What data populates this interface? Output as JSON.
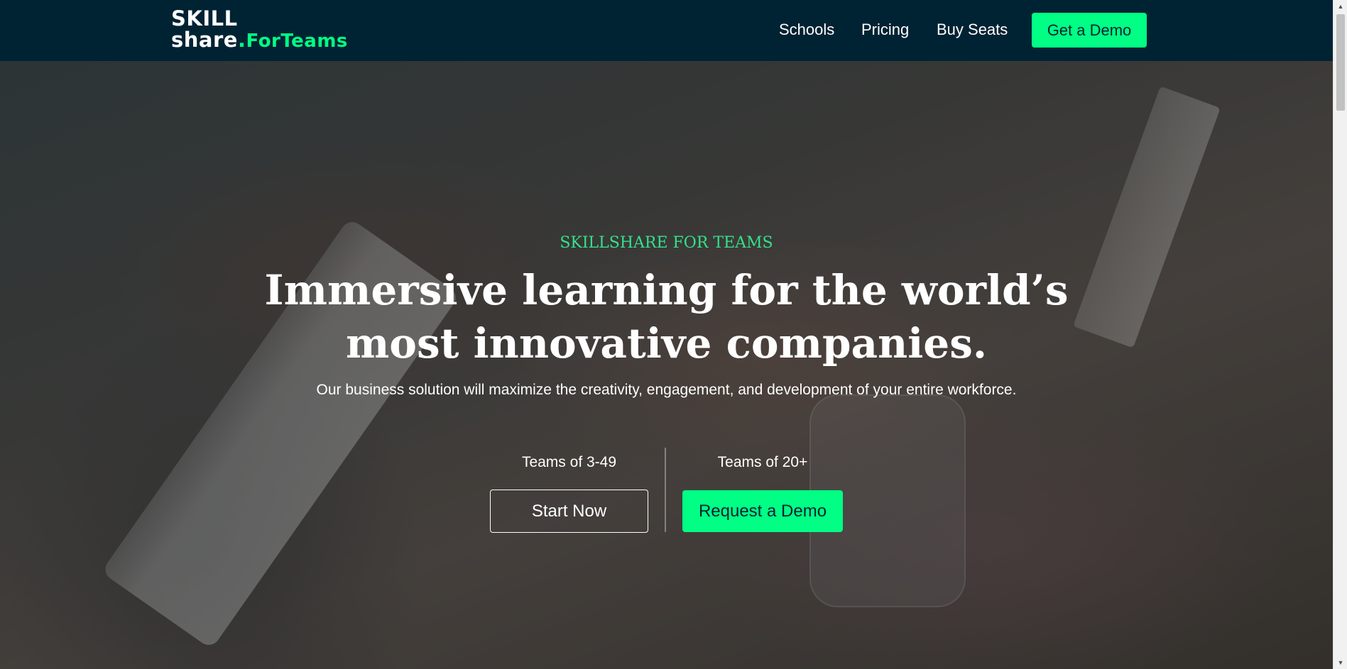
{
  "nav": {
    "logo": {
      "line1": "SKILL",
      "line2": "share",
      "dot": ".",
      "suffix": "ForTeams"
    },
    "links": [
      "Schools",
      "Pricing",
      "Buy Seats"
    ],
    "cta": "Get a Demo"
  },
  "hero": {
    "eyebrow": "SKILLSHARE FOR TEAMS",
    "headline_line1": "Immersive learning for the world’s",
    "headline_line2": "most innovative companies.",
    "subtext": "Our business solution will maximize the creativity, engagement, and development of your entire workforce.",
    "small_team_label": "Teams of 3-49",
    "small_team_button": "Start Now",
    "large_team_label": "Teams of 20+",
    "large_team_button": "Request a Demo"
  },
  "colors": {
    "navbar": "#002333",
    "accent": "#00ff84",
    "eyebrow": "#34e08a"
  }
}
